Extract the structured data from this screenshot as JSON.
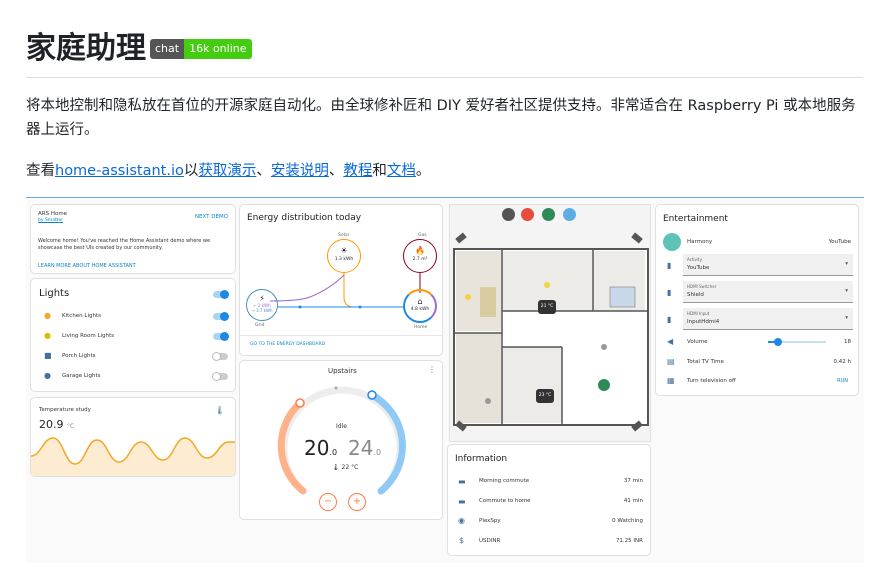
{
  "header": {
    "title": "家庭助理",
    "badge_left": "chat",
    "badge_right": "16k online"
  },
  "intro": "将本地控制和隐私放在首位的开源家庭自动化。由全球修补匠和 DIY 爱好者社区提供支持。非常适合在 Raspberry Pi 或本地服务器上运行。",
  "links_line": {
    "prefix": "查看",
    "site": "home-assistant.io",
    "mid": "以",
    "demo": "获取演示",
    "sep1": "、",
    "install": "安装说明",
    "sep2": "、",
    "tutorials": "教程",
    "and": "和",
    "docs": "文档",
    "end": "。"
  },
  "demo": {
    "ars": {
      "title": "ARS Home",
      "sub": "by Smatter",
      "next": "NEXT DEMO",
      "text1": "Welcome home! You've reached the Home Assistant demo where we",
      "text2": "showcase the best UIs created by our community.",
      "learn": "LEARN MORE ABOUT HOME ASSISTANT"
    },
    "lights": {
      "title": "Lights",
      "items": [
        {
          "label": "Kitchen Lights",
          "on": true
        },
        {
          "label": "Living Room Lights",
          "on": true
        },
        {
          "label": "Porch Lights",
          "on": false
        },
        {
          "label": "Garage Lights",
          "on": false
        }
      ]
    },
    "temperature": {
      "title": "Temperature study",
      "value": "20.9",
      "unit": "°C"
    },
    "energy": {
      "title": "Energy distribution today",
      "solar_label": "Solar",
      "solar_value": "1.3 kWh",
      "gas_label": "Gas",
      "gas_value": "2.7 m³",
      "grid_label": "Grid",
      "grid_in": "← 2 kWh",
      "grid_out": "→ 3.7 kWh",
      "home_label": "Home",
      "home_value": "4.8 kWh",
      "link": "GO TO THE ENERGY DASHBOARD"
    },
    "thermostat": {
      "title": "Upstairs",
      "mode": "Idle",
      "low": "20",
      "low_dec": ".0",
      "high": "24",
      "high_dec": ".0",
      "unit": "°C",
      "current": "22 °C",
      "minus": "−",
      "plus": "+"
    },
    "floorplan": {
      "temp1": "21 °C",
      "temp2": "23 °C"
    },
    "information": {
      "title": "Information",
      "rows": [
        {
          "label": "Morning commute",
          "value": "37 min"
        },
        {
          "label": "Commute to home",
          "value": "41 min"
        },
        {
          "label": "PlexSpy",
          "value": "0 Watching"
        },
        {
          "label": "USDINR",
          "value": "71.25 INR"
        }
      ]
    },
    "entertainment": {
      "title": "Entertainment",
      "harmony": "Harmony",
      "harmony_value": "YouTube",
      "activity_label": "Activity",
      "activity_value": "YouTube",
      "hdmi_switcher_label": "HDMI Switcher",
      "hdmi_switcher_value": "Shield",
      "hdmi_input_label": "HDMI Input",
      "hdmi_input_value": "InputHdmi4",
      "volume_label": "Volume",
      "volume_value": "18",
      "volume_level": 0.18,
      "tv_time_label": "Total TV Time",
      "tv_time_value": "0.42 h",
      "turn_off_label": "Turn television off",
      "turn_off_action": "RUN"
    }
  }
}
